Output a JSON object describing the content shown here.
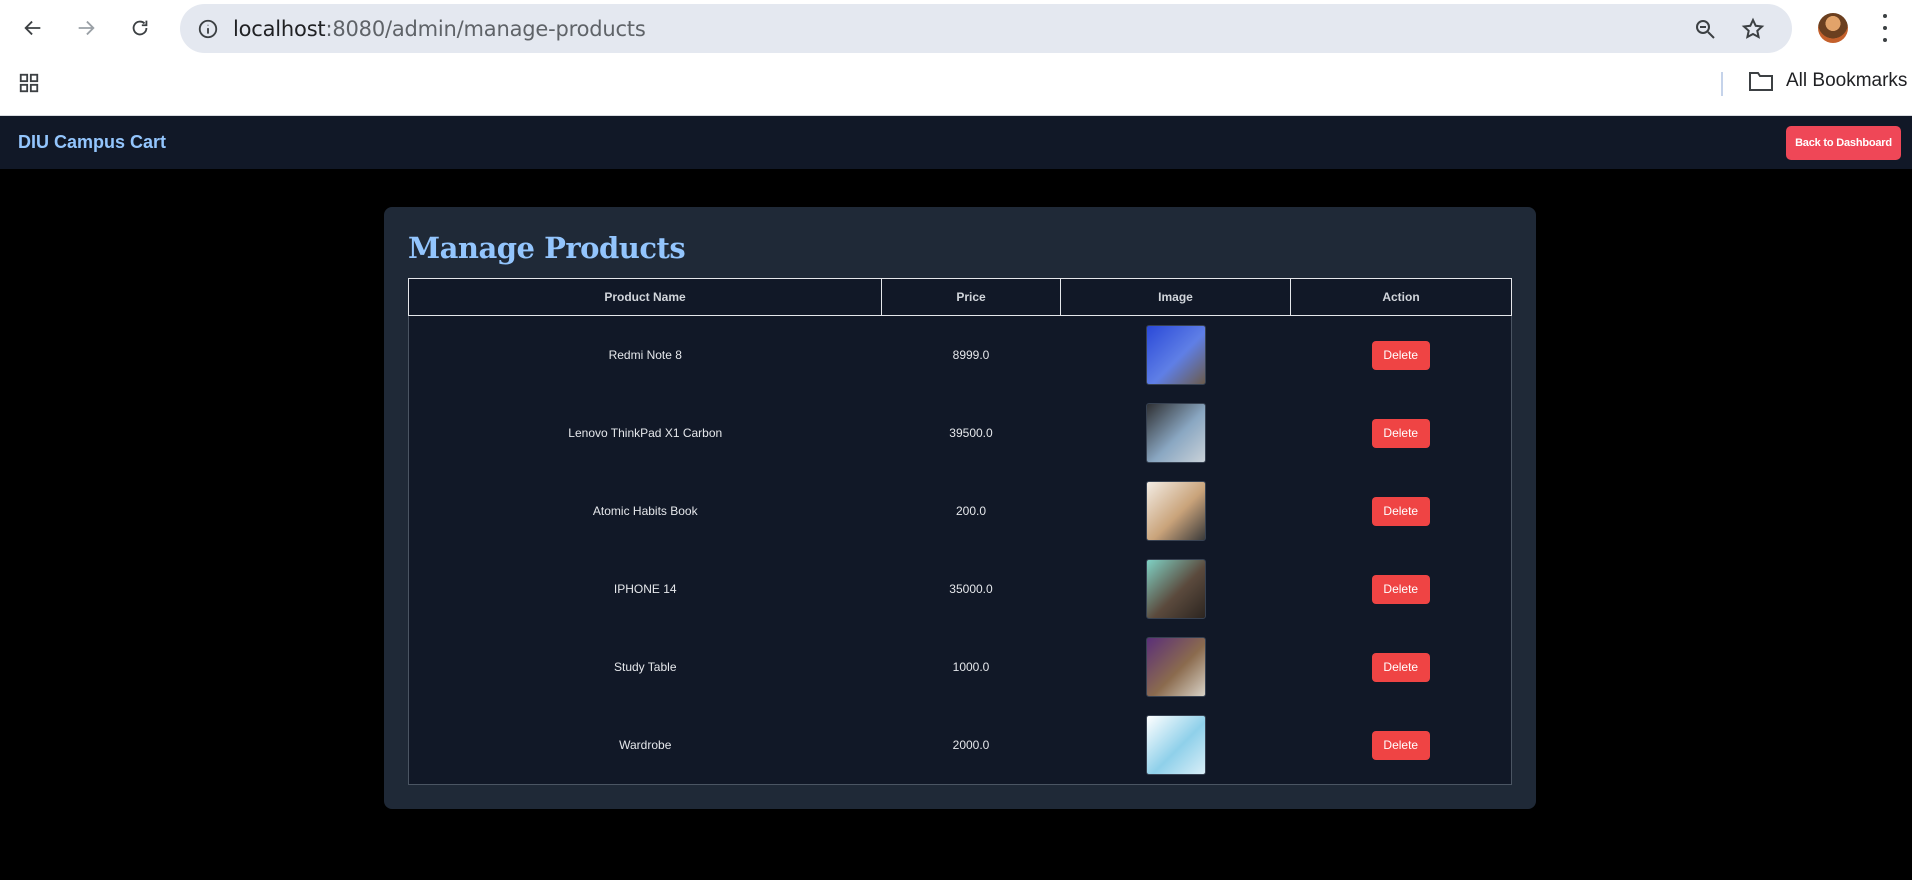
{
  "browser": {
    "url_host": "localhost",
    "url_path": ":8080/admin/manage-products",
    "bookmarks_label": "All Bookmarks"
  },
  "app": {
    "brand": "DIU Campus Cart",
    "back_button": "Back to Dashboard"
  },
  "page": {
    "title": "Manage Products",
    "columns": [
      "Product Name",
      "Price",
      "Image",
      "Action"
    ],
    "products": [
      {
        "name": "Redmi Note 8",
        "price": "8999.0",
        "image_icon": "phone-image",
        "action": "Delete",
        "thumb_colors": [
          "#2a49d8",
          "#5f7fe6",
          "#6b5b4b"
        ]
      },
      {
        "name": "Lenovo ThinkPad X1 Carbon",
        "price": "39500.0",
        "image_icon": "laptop-image",
        "action": "Delete",
        "thumb_colors": [
          "#2f3033",
          "#8aa7c2",
          "#c9d1d8"
        ]
      },
      {
        "name": "Atomic Habits Book",
        "price": "200.0",
        "image_icon": "book-image",
        "action": "Delete",
        "thumb_colors": [
          "#f3ece4",
          "#c9a37a",
          "#3a3a3a"
        ]
      },
      {
        "name": "IPHONE 14",
        "price": "35000.0",
        "image_icon": "phone-image",
        "action": "Delete",
        "thumb_colors": [
          "#7fd1c4",
          "#5b4a3d",
          "#2c2520"
        ]
      },
      {
        "name": "Study Table",
        "price": "1000.0",
        "image_icon": "table-image",
        "action": "Delete",
        "thumb_colors": [
          "#5a2f78",
          "#8b6b4e",
          "#d8d2c6"
        ]
      },
      {
        "name": "Wardrobe",
        "price": "2000.0",
        "image_icon": "wardrobe-image",
        "action": "Delete",
        "thumb_colors": [
          "#ffffff",
          "#8fd0ea",
          "#d9eef7"
        ]
      }
    ]
  },
  "colors": {
    "accent": "#93c5fd",
    "danger": "#ef4444",
    "navbar": "#111827",
    "card": "#1f2937"
  }
}
